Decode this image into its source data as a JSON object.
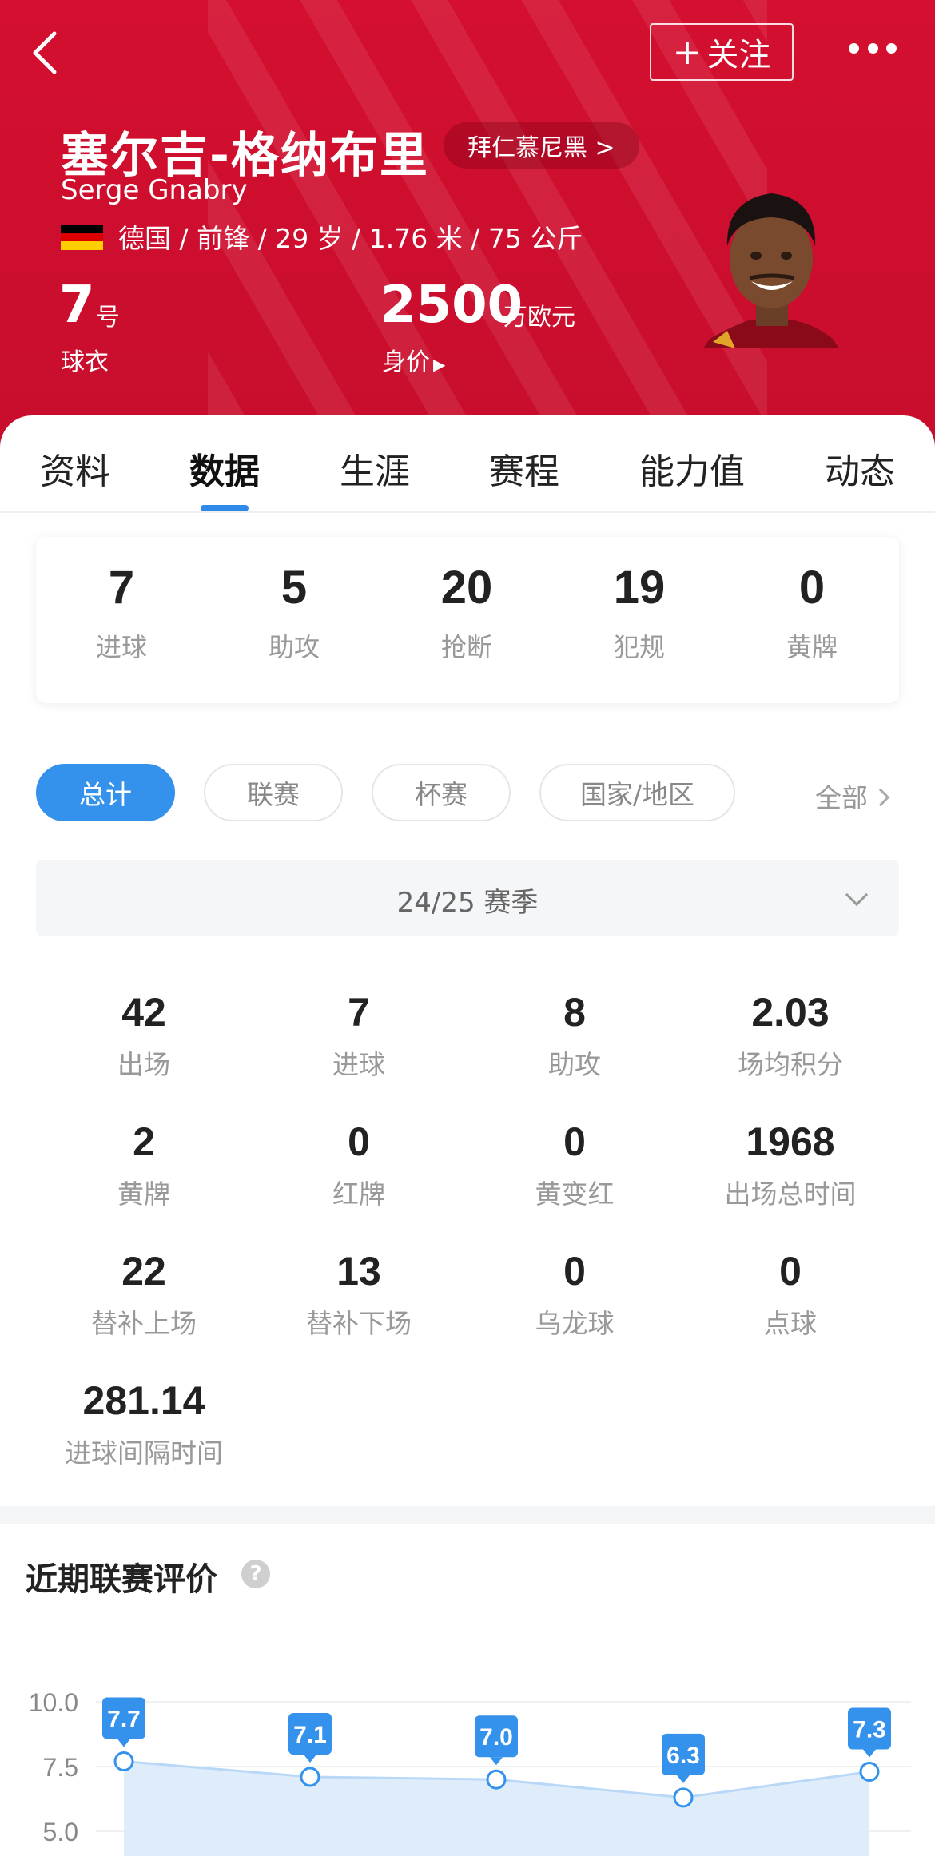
{
  "header": {
    "follow_label": "关注",
    "player_name_cn": "塞尔吉-格纳布里",
    "club_label": "拜仁慕尼黑 >",
    "player_name_en": "Serge Gnabry",
    "flag_colors": [
      "#000000",
      "#dd0000",
      "#ffce00"
    ],
    "bio": "德国 / 前锋 / 29 岁 / 1.76 米 / 75 公斤",
    "shirt_number": "7",
    "shirt_unit": "号",
    "shirt_label": "球衣",
    "market_value": "2500",
    "market_value_unit": "万欧元",
    "market_value_label": "身价"
  },
  "tabs": [
    {
      "label": "资料"
    },
    {
      "label": "数据",
      "active": true
    },
    {
      "label": "生涯"
    },
    {
      "label": "赛程"
    },
    {
      "label": "能力值"
    },
    {
      "label": "动态"
    }
  ],
  "summary": [
    {
      "value": "7",
      "label": "进球"
    },
    {
      "value": "5",
      "label": "助攻"
    },
    {
      "value": "20",
      "label": "抢断"
    },
    {
      "value": "19",
      "label": "犯规"
    },
    {
      "value": "0",
      "label": "黄牌"
    }
  ],
  "filters": [
    {
      "label": "总计",
      "active": true
    },
    {
      "label": "联赛"
    },
    {
      "label": "杯赛"
    },
    {
      "label": "国家/地区"
    }
  ],
  "filter_all_label": "全部",
  "season_label": "24/25 赛季",
  "stats": [
    {
      "value": "42",
      "label": "出场"
    },
    {
      "value": "7",
      "label": "进球"
    },
    {
      "value": "8",
      "label": "助攻"
    },
    {
      "value": "2.03",
      "label": "场均积分"
    },
    {
      "value": "2",
      "label": "黄牌"
    },
    {
      "value": "0",
      "label": "红牌"
    },
    {
      "value": "0",
      "label": "黄变红"
    },
    {
      "value": "1968",
      "label": "出场总时间"
    },
    {
      "value": "22",
      "label": "替补上场"
    },
    {
      "value": "13",
      "label": "替补下场"
    },
    {
      "value": "0",
      "label": "乌龙球"
    },
    {
      "value": "0",
      "label": "点球"
    },
    {
      "value": "281.14",
      "label": "进球间隔时间"
    }
  ],
  "rating_title": "近期联赛评价",
  "help_glyph": "?",
  "chart_data": {
    "type": "area",
    "y_ticks": [
      "10.0",
      "7.5",
      "5.0"
    ],
    "values": [
      7.7,
      7.1,
      7.0,
      6.3,
      7.3
    ],
    "data_labels": [
      "7.7",
      "7.1",
      "7.0",
      "6.3",
      "7.3"
    ],
    "ylim": [
      5.0,
      10.0
    ],
    "color": "#3592ec"
  }
}
